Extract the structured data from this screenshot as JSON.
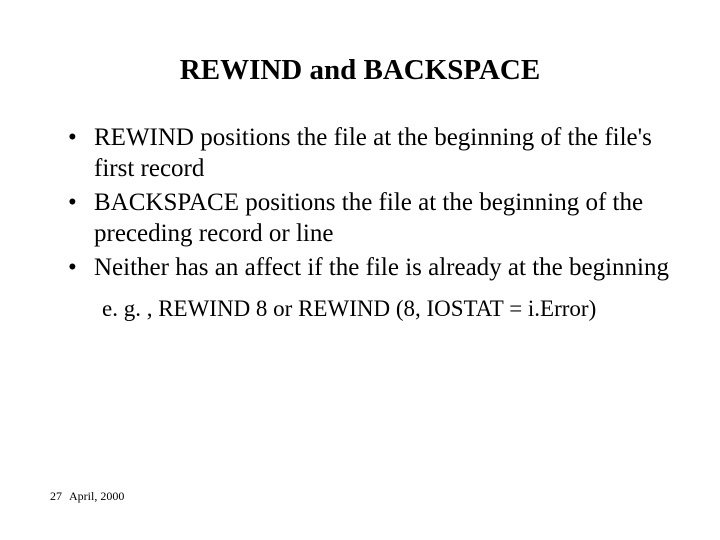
{
  "title": "REWIND and BACKSPACE",
  "bullets": [
    "REWIND positions the file at the beginning of the file's first record",
    "BACKSPACE positions the file at the beginning of the preceding record or line",
    "Neither has an affect if the file is already at the beginning"
  ],
  "example": "e. g. , REWIND 8 or REWIND (8, IOSTAT = i.Error)",
  "footer": {
    "page": "27",
    "date": "April, 2000"
  }
}
